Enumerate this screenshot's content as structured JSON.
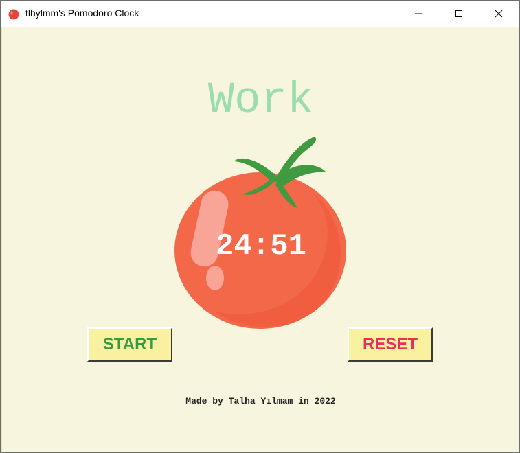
{
  "window": {
    "title": "tlhylmm's Pomodoro Clock",
    "icon": "tomato-icon",
    "controls": {
      "minimize": "minimize-icon",
      "maximize": "maximize-icon",
      "close": "close-icon"
    }
  },
  "timer": {
    "mode_label": "Work",
    "time_left": "24:51"
  },
  "buttons": {
    "start_label": "START",
    "reset_label": "RESET"
  },
  "footer": {
    "credit": "Made by Talha Yılmam in 2022"
  },
  "colors": {
    "background": "#f7f5dd",
    "mode_label": "#9bdeac",
    "start": "#379b46",
    "reset": "#e7305b",
    "button_face": "#f9f0a0",
    "tomato": "#f26849"
  }
}
